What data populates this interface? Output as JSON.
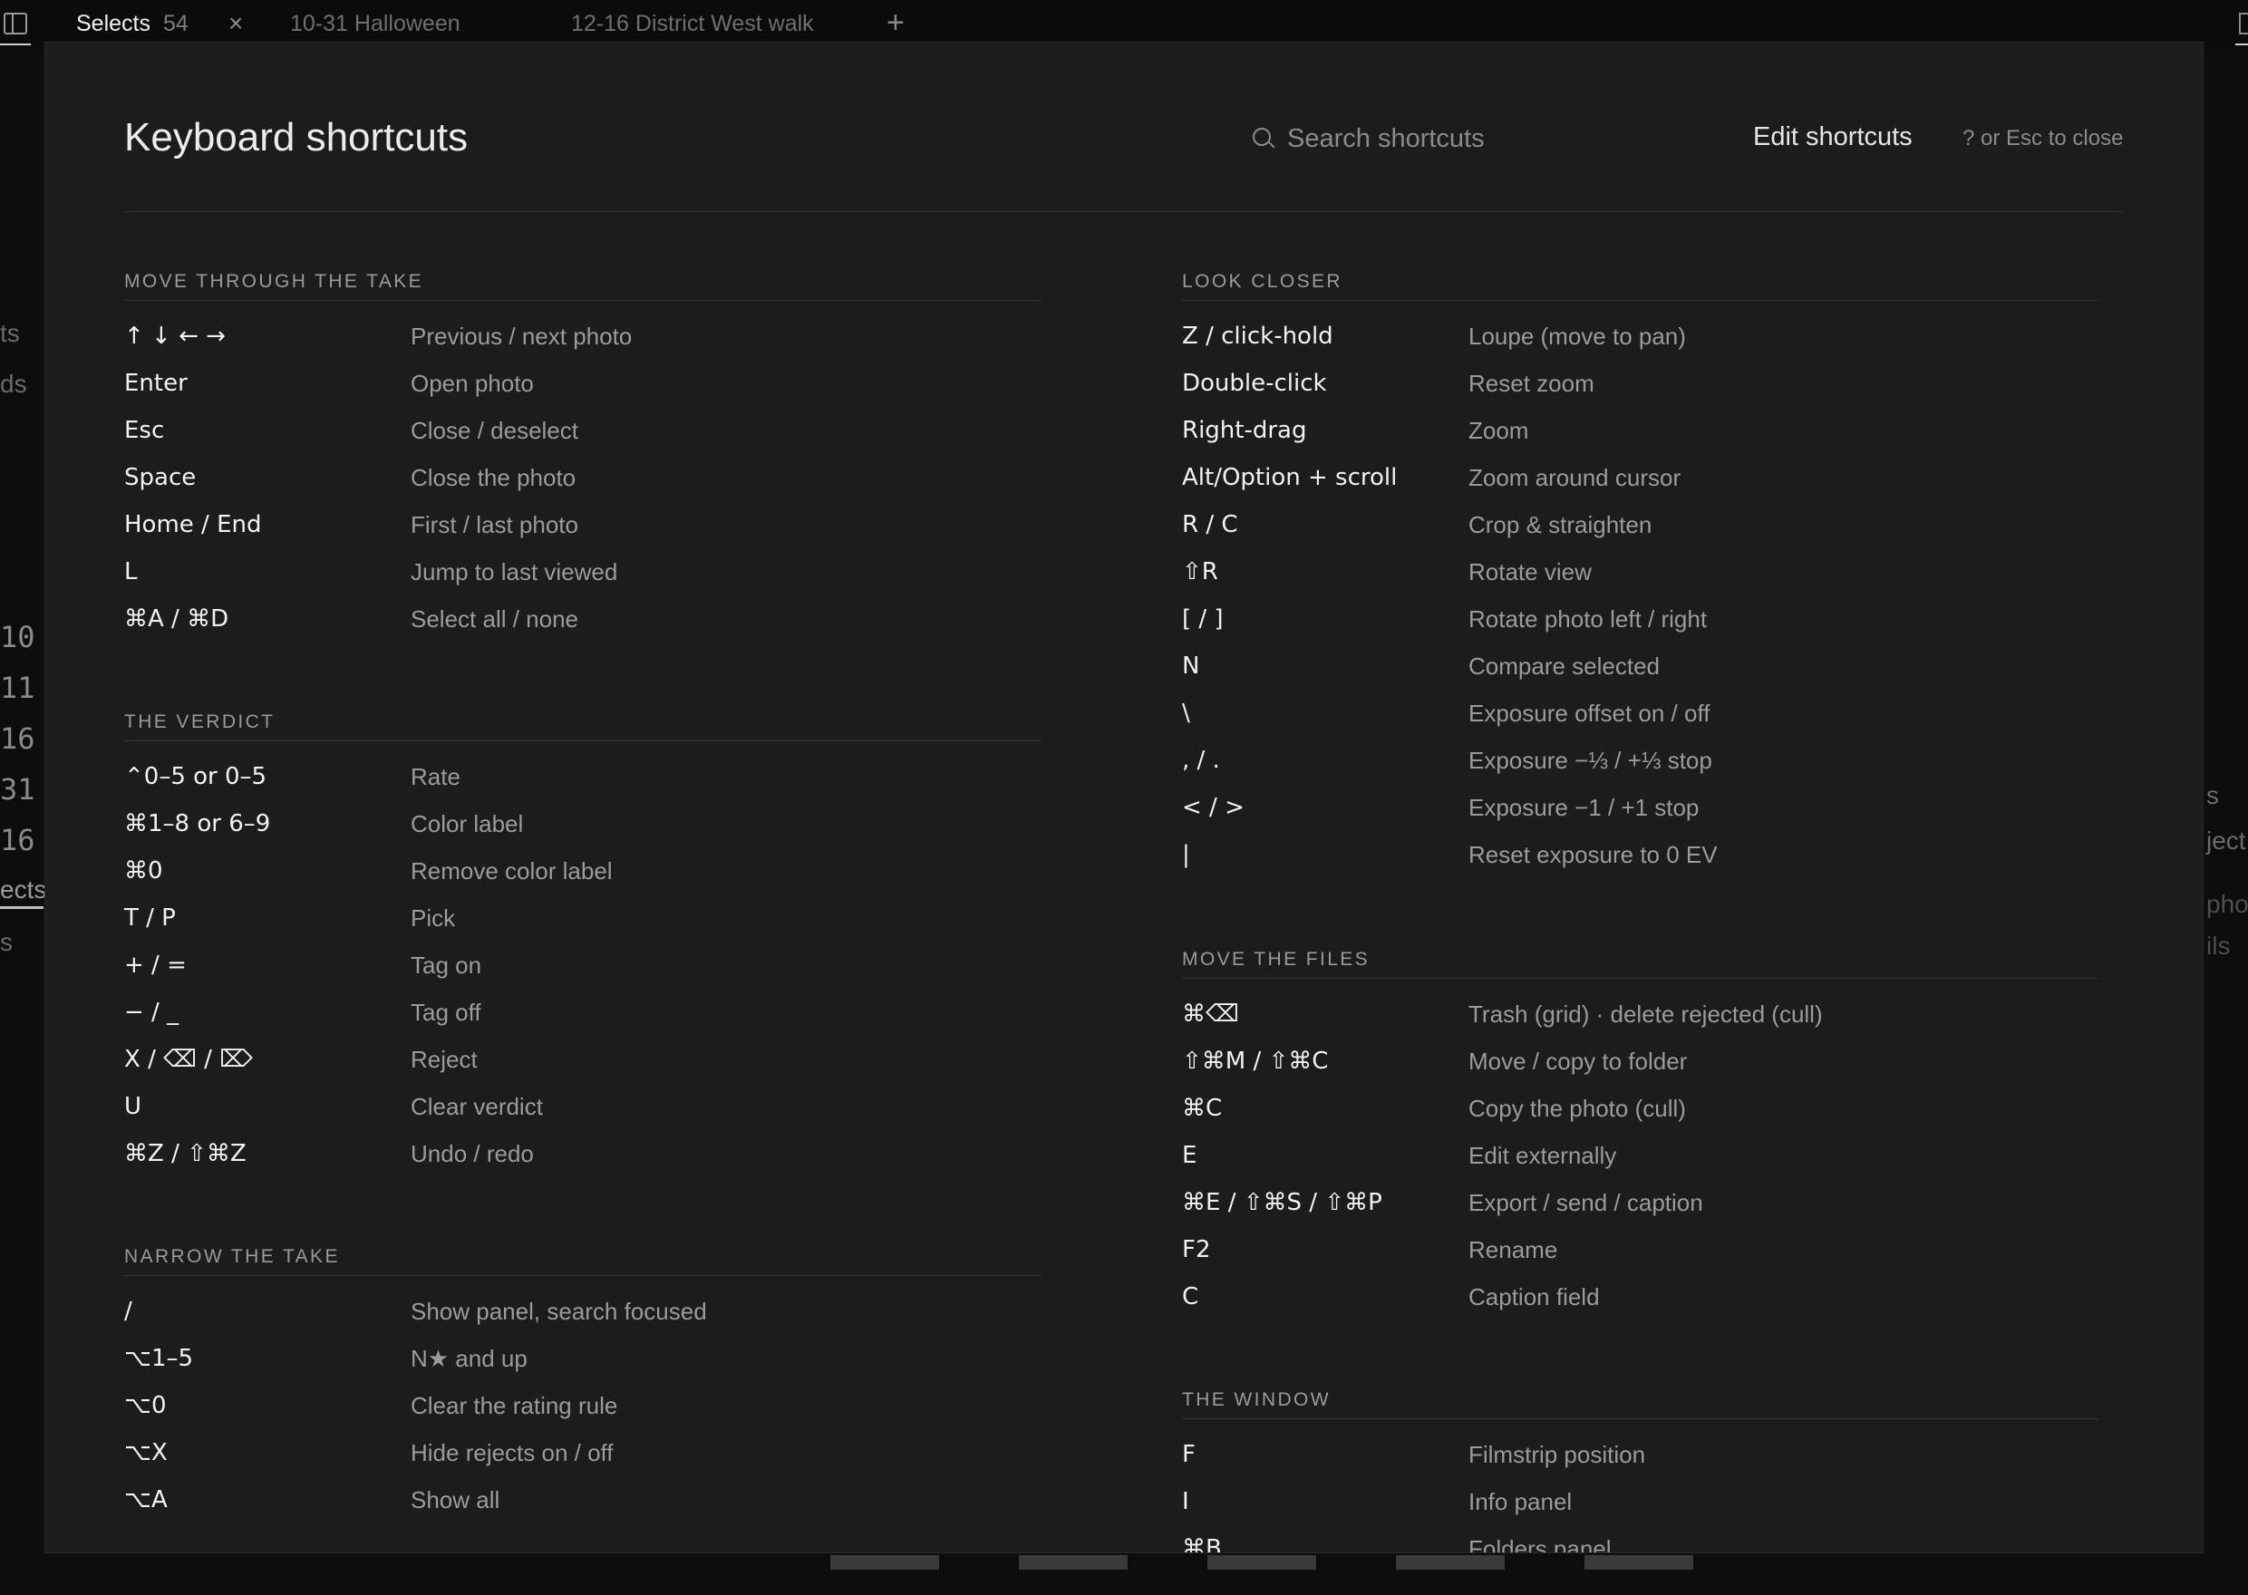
{
  "tabbar": {
    "active_tab_label": "Selects",
    "active_tab_count": "54",
    "close_glyph": "×",
    "tab2_label": "10-31 Halloween",
    "tab3_label": "12-16 District West walk",
    "add_glyph": "+"
  },
  "background": {
    "frag1": "ts",
    "frag2": "ds",
    "nums": [
      "10",
      "11",
      "16",
      "31",
      "16"
    ],
    "frag3": "ects",
    "frag4": "s",
    "right1": "s",
    "right2": "ject",
    "right3": "pho",
    "right4": "ils"
  },
  "modal": {
    "title": "Keyboard shortcuts",
    "search_placeholder": "Search shortcuts",
    "edit_label": "Edit shortcuts",
    "close_hint": "? or Esc to close"
  },
  "sections": {
    "move": {
      "title": "MOVE THROUGH THE TAKE",
      "rows": [
        {
          "key": "↑ ↓ ← →",
          "desc": "Previous / next photo"
        },
        {
          "key": "Enter",
          "desc": "Open photo"
        },
        {
          "key": "Esc",
          "desc": "Close / deselect"
        },
        {
          "key": "Space",
          "desc": "Close the photo"
        },
        {
          "key": "Home / End",
          "desc": "First / last photo"
        },
        {
          "key": "L",
          "desc": "Jump to last viewed"
        },
        {
          "key": "⌘A / ⌘D",
          "desc": "Select all / none"
        }
      ]
    },
    "verdict": {
      "title": "THE VERDICT",
      "rows": [
        {
          "key": "⌃0–5 or 0–5",
          "desc": "Rate"
        },
        {
          "key": "⌘1–8 or 6–9",
          "desc": "Color label"
        },
        {
          "key": "⌘0",
          "desc": "Remove color label"
        },
        {
          "key": "T / P",
          "desc": "Pick"
        },
        {
          "key": "+ / =",
          "desc": "Tag on"
        },
        {
          "key": "− / _",
          "desc": "Tag off"
        },
        {
          "key": "X / ⌫ / ⌦",
          "desc": "Reject"
        },
        {
          "key": "U",
          "desc": "Clear verdict"
        },
        {
          "key": "⌘Z / ⇧⌘Z",
          "desc": "Undo / redo"
        }
      ]
    },
    "narrow": {
      "title": "NARROW THE TAKE",
      "rows": [
        {
          "key": "/",
          "desc": "Show panel, search focused"
        },
        {
          "key": "⌥1–5",
          "desc": "N★ and up"
        },
        {
          "key": "⌥0",
          "desc": "Clear the rating rule"
        },
        {
          "key": "⌥X",
          "desc": "Hide rejects on / off"
        },
        {
          "key": "⌥A",
          "desc": "Show all"
        }
      ]
    },
    "look": {
      "title": "LOOK CLOSER",
      "rows": [
        {
          "key": "Z / click-hold",
          "desc": "Loupe (move to pan)"
        },
        {
          "key": "Double-click",
          "desc": "Reset zoom"
        },
        {
          "key": "Right-drag",
          "desc": "Zoom"
        },
        {
          "key": "Alt/Option + scroll",
          "desc": "Zoom around cursor"
        },
        {
          "key": "R / C",
          "desc": "Crop & straighten"
        },
        {
          "key": "⇧R",
          "desc": "Rotate view"
        },
        {
          "key": "[ / ]",
          "desc": "Rotate photo left / right"
        },
        {
          "key": "N",
          "desc": "Compare selected"
        },
        {
          "key": "\\",
          "desc": "Exposure offset on / off"
        },
        {
          "key": ", / .",
          "desc": "Exposure −⅓ / +⅓ stop"
        },
        {
          "key": "< / >",
          "desc": "Exposure −1 / +1 stop"
        },
        {
          "key": "|",
          "desc": "Reset exposure to 0 EV"
        }
      ]
    },
    "files": {
      "title": "MOVE THE FILES",
      "rows": [
        {
          "key": "⌘⌫",
          "desc": "Trash (grid) · delete rejected (cull)"
        },
        {
          "key": "⇧⌘M / ⇧⌘C",
          "desc": "Move / copy to folder"
        },
        {
          "key": "⌘C",
          "desc": "Copy the photo (cull)"
        },
        {
          "key": "E",
          "desc": "Edit externally"
        },
        {
          "key": "⌘E / ⇧⌘S / ⇧⌘P",
          "desc": "Export / send / caption"
        },
        {
          "key": "F2",
          "desc": "Rename"
        },
        {
          "key": "C",
          "desc": "Caption field"
        }
      ]
    },
    "window": {
      "title": "THE WINDOW",
      "rows": [
        {
          "key": "F",
          "desc": "Filmstrip position"
        },
        {
          "key": "I",
          "desc": "Info panel"
        },
        {
          "key": "⌘B",
          "desc": "Folders panel"
        }
      ]
    }
  }
}
